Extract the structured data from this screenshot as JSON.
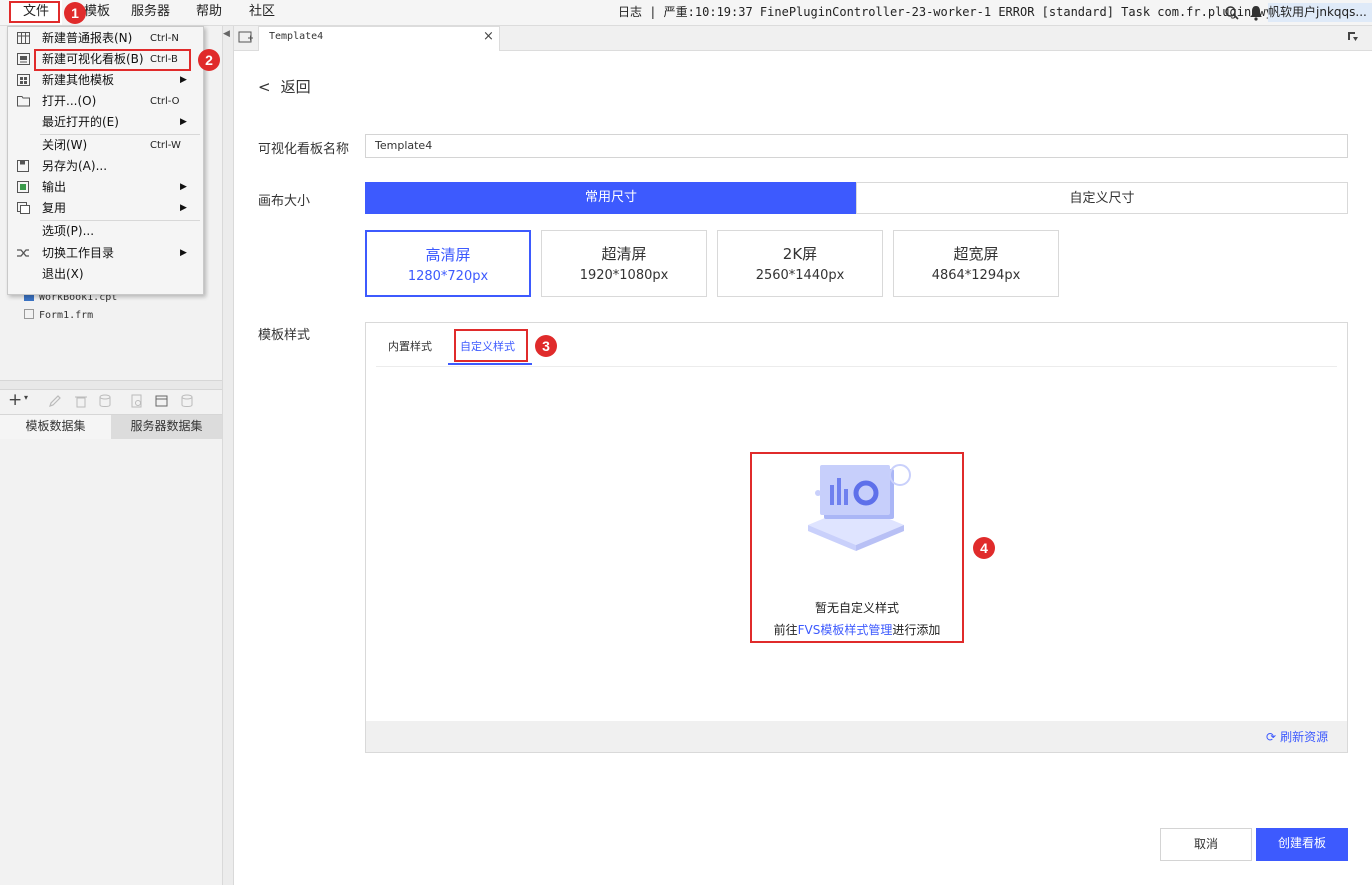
{
  "menubar": {
    "items": [
      "文件",
      "模板",
      "服务器",
      "帮助",
      "社区"
    ],
    "log_text": "日志 | 严重:10:19:37 FinePluginController-23-worker-1 ERROR [standard] Task com.fr.plugin.wysiwyg...",
    "user_text": "帆软用户jnkqqs..."
  },
  "file_menu": {
    "items": [
      {
        "label": "新建普通报表(N)",
        "shortcut": "Ctrl-N",
        "icon": "grid-report-icon"
      },
      {
        "label": "新建可视化看板(B)",
        "shortcut": "Ctrl-B",
        "icon": "dashboard-icon"
      },
      {
        "label": "新建其他模板",
        "shortcut": "",
        "icon": "template-icon",
        "submenu": true
      },
      {
        "label": "打开...(O)",
        "shortcut": "Ctrl-O",
        "icon": "folder-open-icon"
      },
      {
        "label": "最近打开的(E)",
        "shortcut": "",
        "icon": "",
        "submenu": true
      },
      {
        "label": "关闭(W)",
        "shortcut": "Ctrl-W",
        "icon": ""
      },
      {
        "label": "另存为(A)...",
        "shortcut": "",
        "icon": "save-as-icon"
      },
      {
        "label": "输出",
        "shortcut": "",
        "icon": "export-icon",
        "submenu": true
      },
      {
        "label": "复用",
        "shortcut": "",
        "icon": "reuse-icon",
        "submenu": true
      },
      {
        "label": "选项(P)...",
        "shortcut": "",
        "icon": ""
      },
      {
        "label": "切换工作目录",
        "shortcut": "",
        "icon": "shuffle-icon",
        "submenu": true
      },
      {
        "label": "退出(X)",
        "shortcut": "",
        "icon": ""
      }
    ]
  },
  "annotations": [
    "1",
    "2",
    "3",
    "4"
  ],
  "left_panel": {
    "files": [
      "WorkBook1.cpt",
      "Form1.frm"
    ],
    "dataset_tabs": [
      "模板数据集",
      "服务器数据集"
    ]
  },
  "doc_tab": {
    "title": "Template4"
  },
  "form": {
    "back_label": "返回",
    "name_label": "可视化看板名称",
    "name_value": "Template4",
    "canvas_label": "画布大小",
    "size_tabs": [
      "常用尺寸",
      "自定义尺寸"
    ],
    "size_options": [
      {
        "name": "高清屏",
        "dims": "1280*720px"
      },
      {
        "name": "超清屏",
        "dims": "1920*1080px"
      },
      {
        "name": "2K屏",
        "dims": "2560*1440px"
      },
      {
        "name": "超宽屏",
        "dims": "4864*1294px"
      }
    ],
    "style_label": "模板样式",
    "style_tabs": [
      "内置样式",
      "自定义样式"
    ],
    "empty_title": "暂无自定义样式",
    "empty_prefix": "前往",
    "empty_link": "FVS模板样式管理",
    "empty_suffix": "进行添加",
    "refresh_label": "刷新资源",
    "cancel_label": "取消",
    "create_label": "创建看板"
  },
  "colors": {
    "accent": "#3d5afe",
    "annotation": "#e02b2b"
  }
}
